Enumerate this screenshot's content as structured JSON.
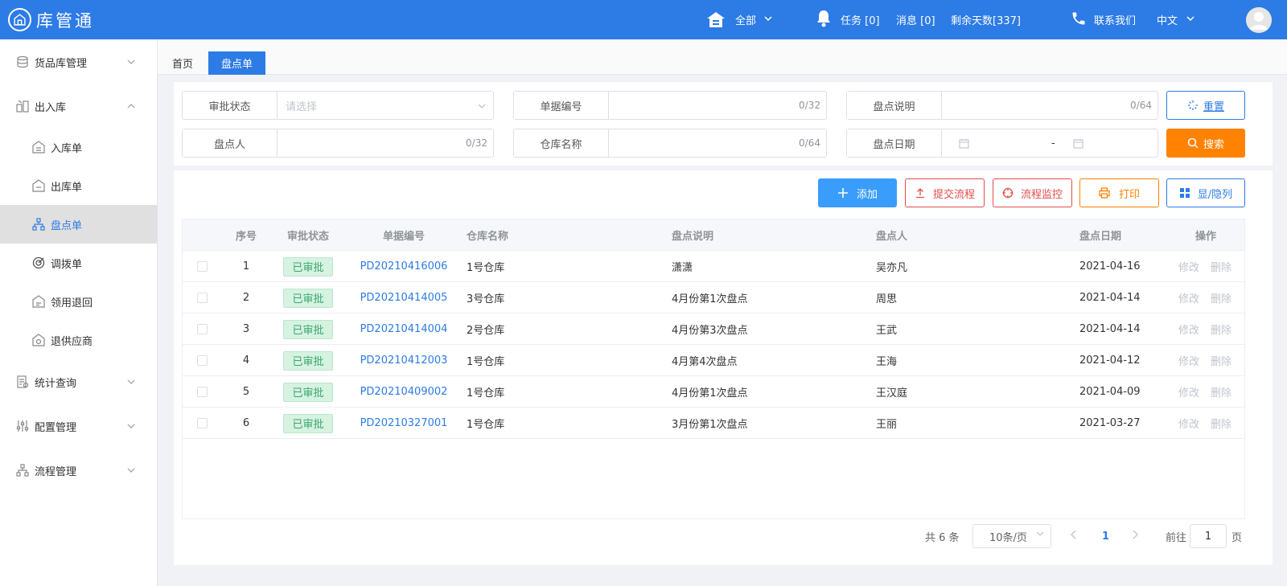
{
  "app": {
    "name": "库管通"
  },
  "header": {
    "warehouse_select": "全部",
    "tasks": "任务 [0]",
    "messages": "消息 [0]",
    "days_left": "剩余天数[337]",
    "contact": "联系我们",
    "language": "中文"
  },
  "sidebar": {
    "items": [
      {
        "label": "货品库管理",
        "icon": "database-icon"
      },
      {
        "label": "出入库",
        "icon": "boxes-icon"
      },
      {
        "label": "入库单",
        "icon": "warehouse-in-icon"
      },
      {
        "label": "出库单",
        "icon": "warehouse-out-icon"
      },
      {
        "label": "盘点单",
        "icon": "hierarchy-icon"
      },
      {
        "label": "调拨单",
        "icon": "transfer-icon"
      },
      {
        "label": "领用退回",
        "icon": "return-icon"
      },
      {
        "label": "退供应商",
        "icon": "supplier-return-icon"
      },
      {
        "label": "统计查询",
        "icon": "report-icon"
      },
      {
        "label": "配置管理",
        "icon": "sliders-icon"
      },
      {
        "label": "流程管理",
        "icon": "flow-icon"
      }
    ]
  },
  "tabs": {
    "home": "首页",
    "active": "盘点单"
  },
  "filters": {
    "status_label": "审批状态",
    "status_placeholder": "请选择",
    "code_label": "单据编号",
    "code_count": "0/32",
    "desc_label": "盘点说明",
    "desc_count": "0/64",
    "person_label": "盘点人",
    "person_count": "0/32",
    "warehouse_label": "仓库名称",
    "warehouse_count": "0/64",
    "date_label": "盘点日期",
    "date_sep": "-"
  },
  "buttons": {
    "reset": "重置",
    "search": "搜索",
    "add": "添加",
    "submit_flow": "提交流程",
    "monitor_flow": "流程监控",
    "print": "打印",
    "toggle_cols": "显/隐列"
  },
  "table": {
    "columns": [
      "序号",
      "审批状态",
      "单据编号",
      "仓库名称",
      "盘点说明",
      "盘点人",
      "盘点日期",
      "操作"
    ],
    "rows": [
      {
        "no": "1",
        "status": "已审批",
        "code": "PD20210416006",
        "warehouse": "1号仓库",
        "desc": "潇潇",
        "person": "吴亦凡",
        "date": "2021-04-16",
        "edit": "修改",
        "delete": "删除"
      },
      {
        "no": "2",
        "status": "已审批",
        "code": "PD20210414005",
        "warehouse": "3号仓库",
        "desc": "4月份第1次盘点",
        "person": "周思",
        "date": "2021-04-14",
        "edit": "修改",
        "delete": "删除"
      },
      {
        "no": "3",
        "status": "已审批",
        "code": "PD20210414004",
        "warehouse": "2号仓库",
        "desc": "4月份第3次盘点",
        "person": "王武",
        "date": "2021-04-14",
        "edit": "修改",
        "delete": "删除"
      },
      {
        "no": "4",
        "status": "已审批",
        "code": "PD20210412003",
        "warehouse": "1号仓库",
        "desc": "4月第4次盘点",
        "person": "王海",
        "date": "2021-04-12",
        "edit": "修改",
        "delete": "删除"
      },
      {
        "no": "5",
        "status": "已审批",
        "code": "PD20210409002",
        "warehouse": "1号仓库",
        "desc": "4月份第1次盘点",
        "person": "王汉庭",
        "date": "2021-04-09",
        "edit": "修改",
        "delete": "删除"
      },
      {
        "no": "6",
        "status": "已审批",
        "code": "PD20210327001",
        "warehouse": "1号仓库",
        "desc": "3月份第1次盘点",
        "person": "王丽",
        "date": "2021-03-27",
        "edit": "修改",
        "delete": "删除"
      }
    ]
  },
  "pagination": {
    "total": "共 6 条",
    "page_size": "10条/页",
    "current": "1",
    "goto_prefix": "前往",
    "goto_value": "1",
    "goto_suffix": "页"
  },
  "colors": {
    "primary": "#2d7be5",
    "orange": "#ff8200",
    "red": "#e34d4d",
    "success_bg": "#d6f2e1",
    "success_text": "#3aa76d"
  }
}
